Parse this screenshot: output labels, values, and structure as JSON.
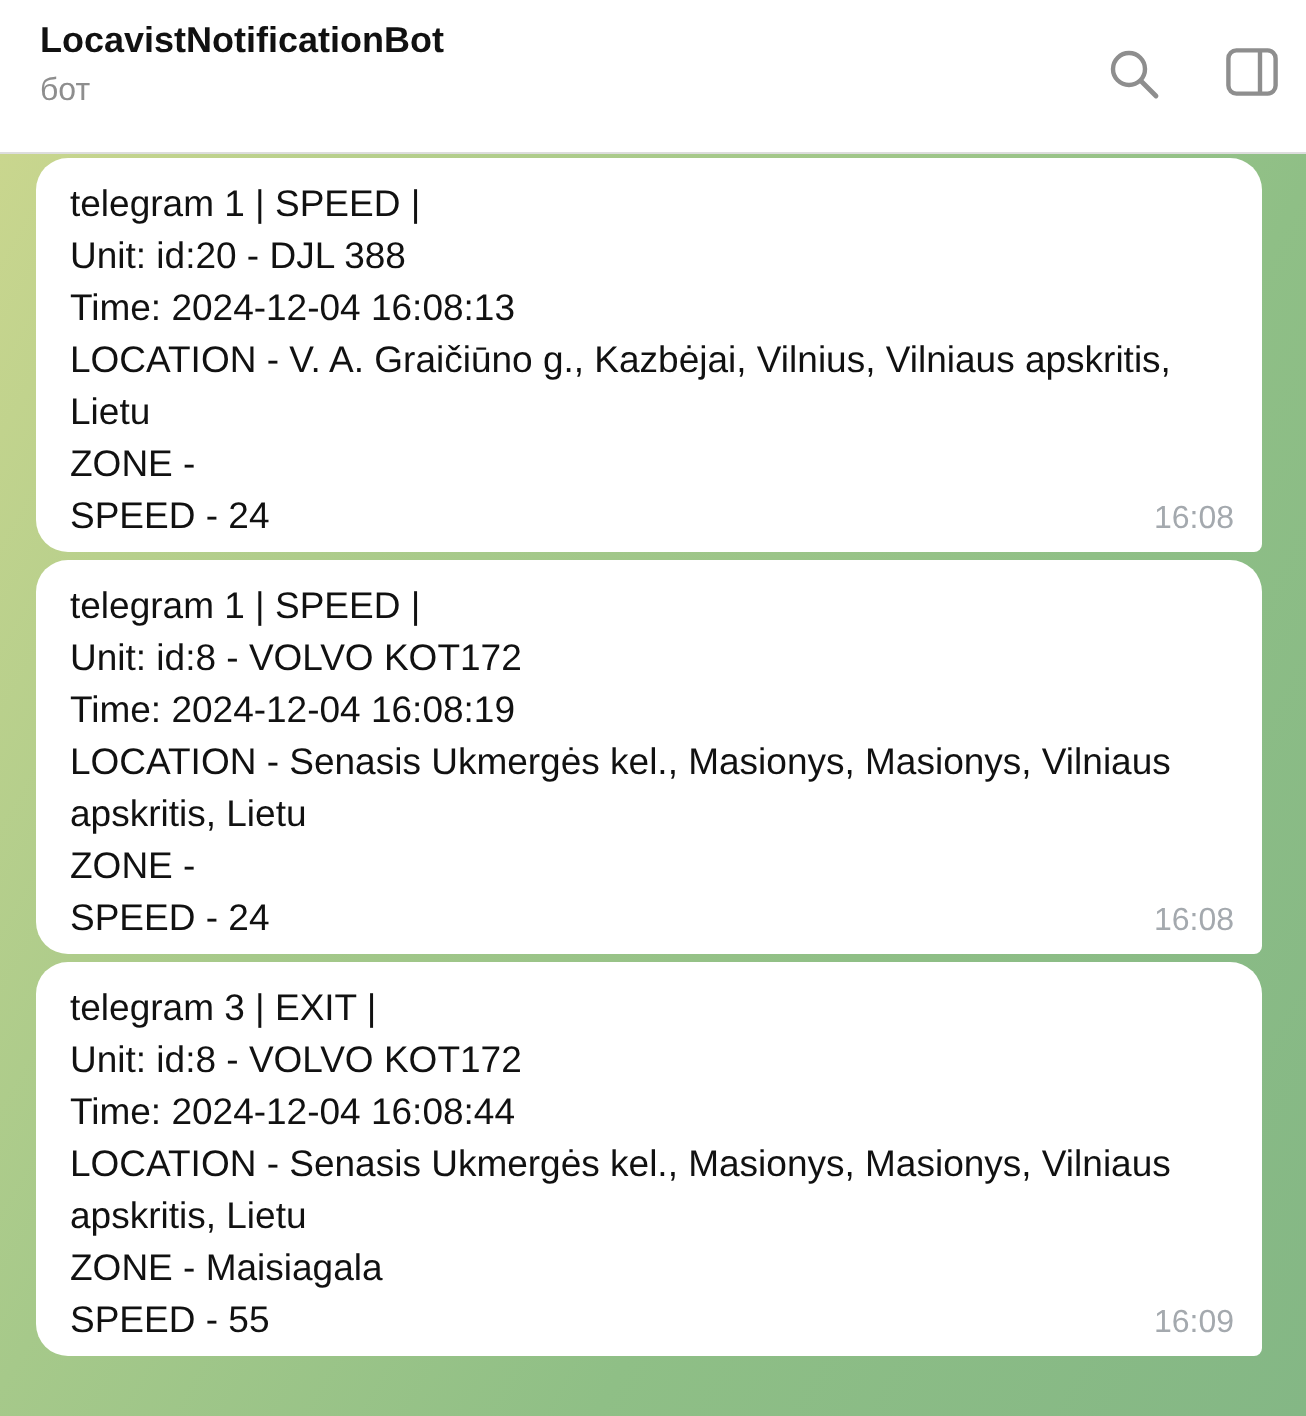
{
  "header": {
    "title": "LocavistNotificationBot",
    "subtitle": "бот"
  },
  "messages": [
    {
      "lines": [
        "telegram 1 | SPEED |",
        "Unit: id:20 - DJL 388",
        "Time: 2024-12-04 16:08:13",
        "LOCATION - V. A. Graičiūno g., Kazbėjai, Vilnius, Vilniaus apskritis, Lietu",
        "ZONE -",
        "SPEED - 24"
      ],
      "time": "16:08"
    },
    {
      "lines": [
        "telegram 1 | SPEED |",
        "Unit: id:8 - VOLVO KOT172",
        "Time: 2024-12-04 16:08:19",
        "LOCATION - Senasis Ukmergės kel., Masionys, Masionys, Vilniaus apskritis, Lietu",
        "ZONE -",
        "SPEED - 24"
      ],
      "time": "16:08"
    },
    {
      "lines": [
        "telegram 3 | EXIT |",
        "Unit: id:8 - VOLVO KOT172",
        "Time: 2024-12-04 16:08:44",
        "LOCATION - Senasis Ukmergės kel., Masionys, Masionys, Vilniaus apskritis, Lietu",
        "ZONE - Maisiagala",
        "SPEED - 55"
      ],
      "time": "16:09"
    }
  ]
}
